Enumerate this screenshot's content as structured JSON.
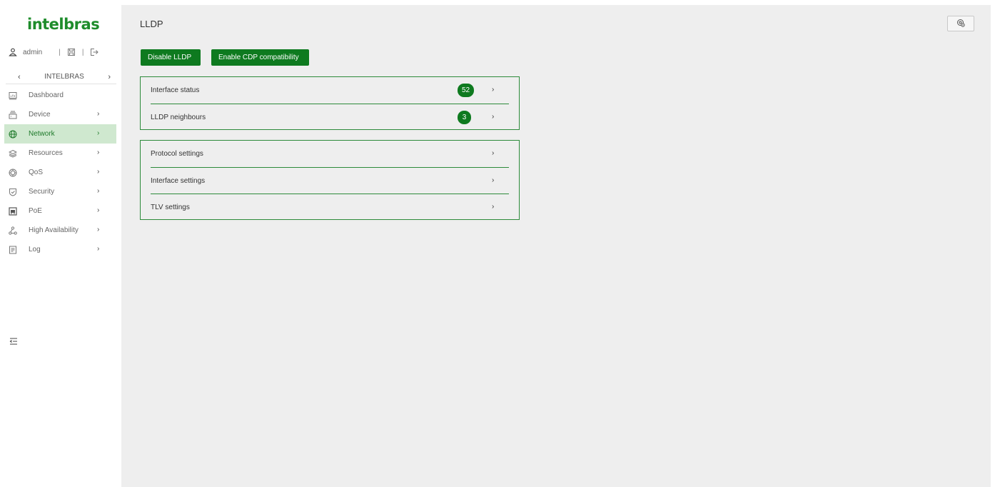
{
  "brand": {
    "logo_text": "intelbras",
    "accent": "#0e7a1f"
  },
  "user": {
    "name": "admin"
  },
  "org": {
    "name": "INTELBRAS",
    "prev": "‹",
    "next": "›"
  },
  "nav": [
    {
      "label": "Dashboard",
      "icon": "dashboard-icon",
      "chevron": ""
    },
    {
      "label": "Device",
      "icon": "device-icon",
      "chevron": "›"
    },
    {
      "label": "Network",
      "icon": "globe-icon",
      "chevron": "›",
      "active": true
    },
    {
      "label": "Resources",
      "icon": "layers-icon",
      "chevron": "›"
    },
    {
      "label": "QoS",
      "icon": "qos-icon",
      "chevron": "›"
    },
    {
      "label": "Security",
      "icon": "shield-icon",
      "chevron": "›"
    },
    {
      "label": "PoE",
      "icon": "poe-icon",
      "chevron": "›"
    },
    {
      "label": "High Availability",
      "icon": "cluster-icon",
      "chevron": "›"
    },
    {
      "label": "Log",
      "icon": "log-icon",
      "chevron": "›"
    }
  ],
  "page": {
    "title": "LLDP"
  },
  "actions": {
    "disable": "Disable LLDP",
    "cdp": "Enable CDP compatibility"
  },
  "status_panel": {
    "rows": [
      {
        "label": "Interface status",
        "count": "52",
        "chevron": "›"
      },
      {
        "label": "LLDP neighbours",
        "count": "3",
        "chevron": "›"
      }
    ]
  },
  "settings_panel": {
    "rows": [
      {
        "label": "Protocol settings",
        "chevron": "›"
      },
      {
        "label": "Interface settings",
        "chevron": "›"
      },
      {
        "label": "TLV settings",
        "chevron": "›"
      }
    ]
  }
}
